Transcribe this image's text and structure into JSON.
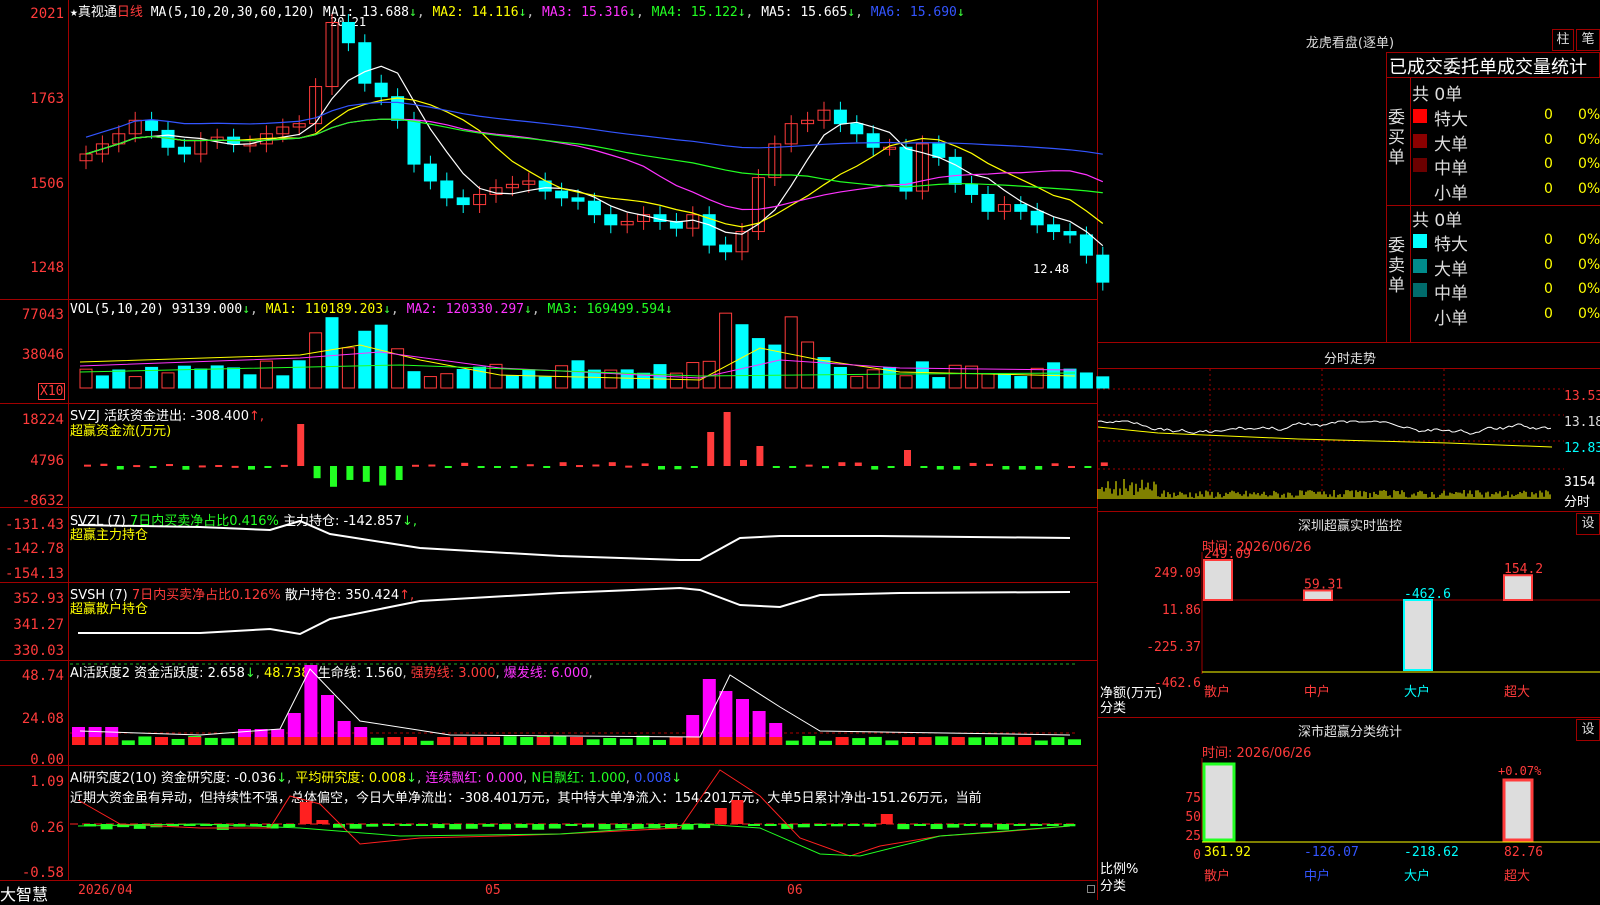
{
  "colors": {
    "up": "#ff3b3b",
    "down": "#00ffff",
    "border": "#a00000",
    "ma1": "#ffffff",
    "ma2": "#ffff00",
    "ma3": "#ff33ff",
    "ma4": "#22ff22",
    "ma5": "#555555",
    "ma6": "#3355ff"
  },
  "main": {
    "star": "★",
    "stock_name": "真视通",
    "period": "日线",
    "ma_params": "MA(5,10,20,30,60,120)",
    "ma1_label": "MA1: 13.688",
    "ma2_label": "MA2: 14.116",
    "ma3_label": "MA3: 15.316",
    "ma4_label": "MA4: 15.122",
    "ma5_label": "MA5: 15.665",
    "ma6_label": "MA6: 15.690",
    "arrow": "↓",
    "yticks": [
      "2021",
      "1763",
      "1506",
      "1248"
    ],
    "high_label": "20.21",
    "low_label": "12.48"
  },
  "vol": {
    "params": "VOL(5,10,20)",
    "value": "93139.000",
    "ma1_label": "MA1: 110189.203",
    "ma2_label": "MA2: 120330.297",
    "ma3_label": "MA3: 169499.594",
    "yticks": [
      "77043",
      "38046"
    ],
    "unit": "X10"
  },
  "svzj": {
    "label": "SVZJ  活跃资金进出: -308.400",
    "up_arrow": "↑,",
    "sub": "超赢资金流(万元)",
    "yticks": [
      "18224",
      "4796",
      "-8632"
    ]
  },
  "svzl": {
    "label": "SVZL (7)",
    "ratio": "7日内买卖净占比0.416%",
    "hold": "主力持仓: -142.857",
    "arrow": "↓,",
    "sub": "超赢主力持仓",
    "yticks": [
      "-131.43",
      "-142.78",
      "-154.13"
    ]
  },
  "svsh": {
    "label": "SVSH (7)",
    "ratio": "7日内买卖净占比0.126%",
    "hold": "散户持仓: 350.424",
    "arrow": "↑,",
    "sub": "超赢散户持仓",
    "yticks": [
      "352.93",
      "341.27",
      "330.03"
    ]
  },
  "aihy": {
    "label": "AI活跃度2 资金活跃度: 2.658",
    "v2": "48.738",
    "life": "生命线: 1.560",
    "strong": "强势线: 3.000",
    "burst": "爆发线: 6.000",
    "yticks": [
      "48.74",
      "24.08",
      "0.00"
    ]
  },
  "aiyj": {
    "label": "AI研究度2(10) 资金研究度: -0.036",
    "avg": "平均研究度: 0.008",
    "cont": "连续飘红: 0.000",
    "nday": "N日飘红: 1.000",
    "last": "0.008",
    "text": "近期大资金虽有异动，但持续性不强，总体偏空，今日大单净流出：-308.401万元，其中特大单净流入：154.201万元，大单5日累计净出-151.26万元，当前",
    "yticks": [
      "1.09",
      "0.26",
      "-0.58"
    ]
  },
  "xaxis": {
    "brand": "大智慧",
    "d1": "2026/04",
    "d2": "05",
    "d3": "06"
  },
  "longhu": {
    "title": "龙虎看盘(逐单)",
    "tab1": "柱",
    "tab2": "笔",
    "header": "已成交委托单成交量统计",
    "buy_label": "委买单",
    "sell_label": "委卖单",
    "buy_total": "共 0单",
    "sell_total": "共 0单",
    "buy_rows": [
      {
        "name": "特大",
        "count": "0",
        "pct": "0%",
        "color": "#ff0000"
      },
      {
        "name": "大单",
        "count": "0",
        "pct": "0%",
        "color": "#8b0000"
      },
      {
        "name": "中单",
        "count": "0",
        "pct": "0%",
        "color": "#6b0000"
      },
      {
        "name": "小单",
        "count": "0",
        "pct": "0%",
        "color": "#000000"
      }
    ],
    "sell_rows": [
      {
        "name": "特大",
        "count": "0",
        "pct": "0%",
        "color": "#00ffff"
      },
      {
        "name": "大单",
        "count": "0",
        "pct": "0%",
        "color": "#008b8b"
      },
      {
        "name": "中单",
        "count": "0",
        "pct": "0%",
        "color": "#006b6b"
      },
      {
        "name": "小单",
        "count": "0",
        "pct": "0%",
        "color": "#000000"
      }
    ]
  },
  "fenshi": {
    "title": "分时走势",
    "yticks": [
      "13.53",
      "13.18",
      "12.83"
    ],
    "vol_tick": "3154",
    "unit": "分时"
  },
  "sz_monitor": {
    "title": "深圳超赢实时监控",
    "btn": "设",
    "time": "时间: 2026/06/26",
    "yticks": [
      "249.09",
      "11.86",
      "-225.37",
      "-462.6"
    ],
    "ylabel": "净额(万元)",
    "xlabel": "分类",
    "bars": [
      {
        "cat": "散户",
        "value": 249.09,
        "label": "249.09"
      },
      {
        "cat": "中户",
        "value": 59.31,
        "label": "59.31"
      },
      {
        "cat": "大户",
        "value": -462.6,
        "label": "-462.6"
      },
      {
        "cat": "超大",
        "value": 154.2,
        "label": "154.2"
      }
    ]
  },
  "sz_class": {
    "title": "深市超赢分类统计",
    "btn": "设",
    "time": "时间: 2026/06/26",
    "yticks": [
      "75",
      "50",
      "25",
      "0"
    ],
    "ylabel": "比例%",
    "xlabel": "分类",
    "top_label": "+0.07%",
    "bars": [
      {
        "cat": "散户",
        "value": "361.92"
      },
      {
        "cat": "中户",
        "value": "-126.07"
      },
      {
        "cat": "大户",
        "value": "-218.62"
      },
      {
        "cat": "超大",
        "value": "82.76"
      }
    ]
  }
}
